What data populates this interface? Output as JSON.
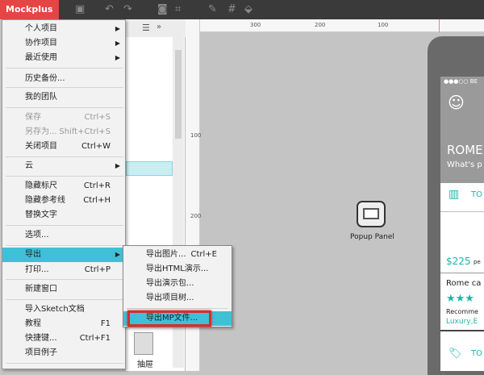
{
  "app": {
    "brand": "Mockplus ▾"
  },
  "toolbar": {
    "icons": [
      "save-icon",
      "undo-icon",
      "redo-icon",
      "frame-icon",
      "crop-icon",
      "brush-icon",
      "grid-icon",
      "fill-icon"
    ]
  },
  "rulers": {
    "top": [
      "300",
      "200",
      "100"
    ],
    "left": [
      "100",
      "200"
    ]
  },
  "menu": {
    "items": [
      {
        "label": "个人项目",
        "arrow": "▶"
      },
      {
        "label": "协作项目",
        "arrow": "▶"
      },
      {
        "label": "最近使用",
        "arrow": "▶"
      },
      {
        "label": "历史备份..."
      },
      {
        "label": "我的团队"
      },
      {
        "label": "保存",
        "shortcut": "Ctrl+S",
        "disabled": true
      },
      {
        "label": "另存为...",
        "shortcut": "Shift+Ctrl+S",
        "disabled": true
      },
      {
        "label": "关闭项目",
        "shortcut": "Ctrl+W"
      },
      {
        "label": "云",
        "arrow": "▶"
      },
      {
        "label": "隐藏标尺",
        "shortcut": "Ctrl+R"
      },
      {
        "label": "隐藏参考线",
        "shortcut": "Ctrl+H"
      },
      {
        "label": "替换文字"
      },
      {
        "label": "选项..."
      },
      {
        "label": "导出",
        "arrow": "▶",
        "highlighted": true
      },
      {
        "label": "打印...",
        "shortcut": "Ctrl+P"
      },
      {
        "label": "新建窗口"
      },
      {
        "label": "导入Sketch文档"
      },
      {
        "label": "教程",
        "shortcut": "F1"
      },
      {
        "label": "快捷键...",
        "shortcut": "Ctrl+F1"
      },
      {
        "label": "项目例子"
      }
    ]
  },
  "submenu": {
    "items": [
      {
        "label": "导出图片...",
        "shortcut": "Ctrl+E"
      },
      {
        "label": "导出HTML演示..."
      },
      {
        "label": "导出演示包..."
      },
      {
        "label": "导出项目树..."
      },
      {
        "label": "导出MP文件...",
        "highlighted": true
      }
    ]
  },
  "panel": {
    "component_label": "抽屉",
    "more": "»"
  },
  "canvas": {
    "popup_label": "Popup Panel"
  },
  "phone": {
    "status": "●●●○○ BE",
    "title": "ROME",
    "subtitle": "What's p",
    "row1": "TO",
    "price": "$225",
    "price_suffix": "pe",
    "card_title": "Rome ca",
    "stars": "★★★",
    "recommend": "Recomme",
    "tags": "Luxury,E",
    "row2": "TO"
  },
  "colors": {
    "accent": "#3fc0d6",
    "brand": "#e64545",
    "teal": "#1fb5a8",
    "highlight_border": "#d32f2f"
  }
}
